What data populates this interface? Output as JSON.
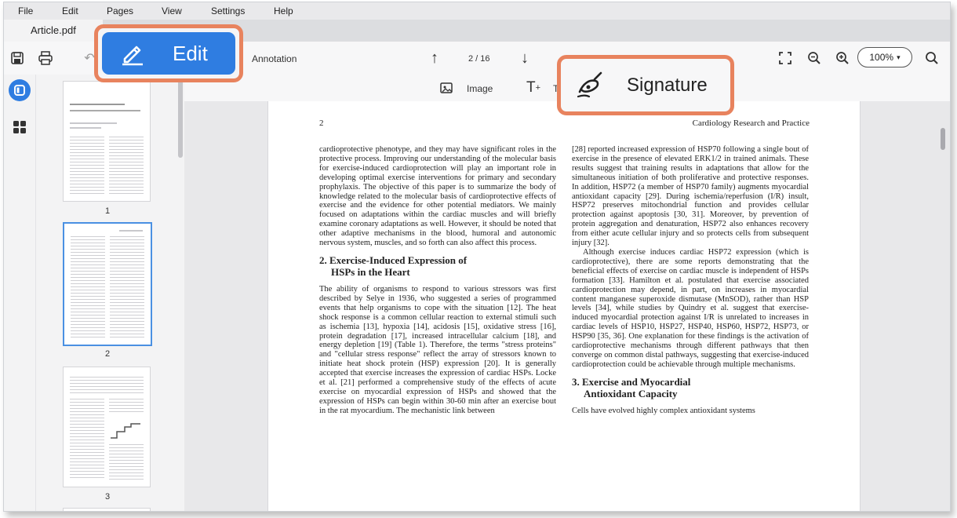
{
  "menu": [
    "File",
    "Edit",
    "Pages",
    "View",
    "Settings",
    "Help"
  ],
  "tab": {
    "title": "Article.pdf"
  },
  "toolbar": {
    "annotation_label": "Annotation",
    "page_indicator": "2 / 16",
    "zoom": "100%"
  },
  "subbar": {
    "image_label": "Image",
    "text_label": "T"
  },
  "callouts": {
    "edit_label": "Edit",
    "signature_label": "Signature"
  },
  "thumbnails": [
    {
      "label": "1"
    },
    {
      "label": "2"
    },
    {
      "label": "3"
    }
  ],
  "document": {
    "page_number": "2",
    "journal": "Cardiology Research and Practice",
    "col1_p1": "cardioprotective phenotype, and they may have significant roles in the protective process. Improving our understanding of the molecular basis for exercise-induced cardioprotection will play an important role in developing optimal exercise interventions for primary and secondary prophylaxis. The objective of this paper is to summarize the body of knowledge related to the molecular basis of cardioprotective effects of exercise and the evidence for other potential mediators. We mainly focused on adaptations within the cardiac muscles and will briefly examine coronary adaptations as well. However, it should be noted that other adaptive mechanisms in the blood, humoral and autonomic nervous system, muscles, and so forth can also affect this process.",
    "heading2_line1": "2. Exercise-Induced Expression of",
    "heading2_line2": "HSPs in the Heart",
    "col1_p2": "The ability of organisms to respond to various stressors was first described by Selye in 1936, who suggested a series of programmed events that help organisms to cope with the situation [12]. The heat shock response is a common cellular reaction to external stimuli such as ischemia [13], hypoxia [14], acidosis [15], oxidative stress [16], protein degradation [17], increased intracellular calcium [18], and energy depletion [19] (Table 1). Therefore, the terms \"stress proteins\" and \"cellular stress response\" reflect the array of stressors known to initiate heat shock protein (HSP) expression [20]. It is generally accepted that exercise increases the expression of cardiac HSPs. Locke et al. [21] performed a comprehensive study of the effects of acute exercise on myocardial expression of HSPs and showed that the expression of HSPs can begin within 30-60 min after an exercise bout in the rat myocardium. The mechanistic link between",
    "col2_p1": "[28] reported increased expression of HSP70 following a single bout of exercise in the presence of elevated ERK1/2 in trained animals. These results suggest that training results in adaptations that allow for the simultaneous initiation of both proliferative and protective responses. In addition, HSP72 (a member of HSP70 family) augments myocardial antioxidant capacity [29]. During ischemia/reperfusion (I/R) insult, HSP72 preserves mitochondrial function and provides cellular protection against apoptosis [30, 31]. Moreover, by prevention of protein aggregation and denaturation, HSP72 also enhances recovery from either acute cellular injury and so protects cells from subsequent injury [32].",
    "col2_p2": "Although exercise induces cardiac HSP72 expression (which is cardioprotective), there are some reports demonstrating that the beneficial effects of exercise on cardiac muscle is independent of HSPs formation [33]. Hamilton et al. postulated that exercise associated cardioprotection may depend, in part, on increases in myocardial content manganese superoxide dismutase (MnSOD), rather than HSP levels [34], while studies by Quindry et al. suggest that exercise-induced myocardial protection against I/R is unrelated to increases in cardiac levels of HSP10, HSP27, HSP40, HSP60, HSP72, HSP73, or HSP90 [35, 36]. One explanation for these findings is the activation of cardioprotective mechanisms through different pathways that then converge on common distal pathways, suggesting that exercise-induced cardioprotection could be achievable through multiple mechanisms.",
    "heading3_line1": "3. Exercise and Myocardial",
    "heading3_line2": "Antioxidant Capacity",
    "col2_p3": "Cells have evolved highly complex antioxidant systems"
  }
}
